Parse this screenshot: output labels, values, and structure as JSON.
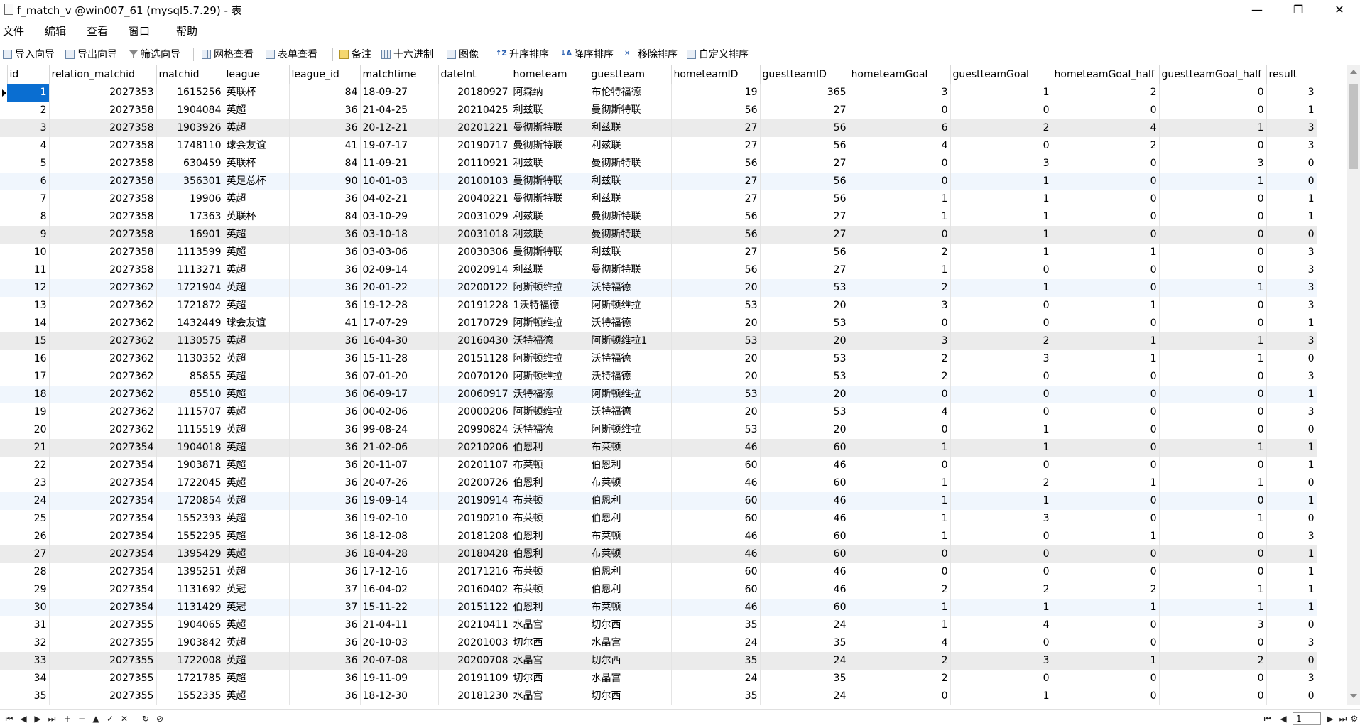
{
  "window": {
    "title": "f_match_v @win007_61 (mysql5.7.29) - 表",
    "minimize": "—",
    "maximize": "❐",
    "close": "✕"
  },
  "menu": {
    "items": [
      "文件",
      "编辑",
      "查看",
      "窗口",
      "帮助"
    ]
  },
  "toolbar": {
    "import": "导入向导",
    "export": "导出向导",
    "filter": "筛选向导",
    "grid_view": "网格查看",
    "form_view": "表单查看",
    "memo": "备注",
    "hex": "十六进制",
    "image": "图像",
    "sort_asc": "升序排序",
    "sort_desc": "降序排序",
    "remove_sort": "移除排序",
    "custom_sort": "自定义排序"
  },
  "table": {
    "columns": [
      "id",
      "relation_matchid",
      "matchid",
      "league",
      "league_id",
      "matchtime",
      "dateInt",
      "hometeam",
      "guestteam",
      "hometeamID",
      "guestteamID",
      "hometeamGoal",
      "guestteamGoal",
      "hometeamGoal_half",
      "guestteamGoal_half",
      "result"
    ],
    "rows": [
      [
        "1",
        "2027353",
        "1615256",
        "英联杯",
        "84",
        "18-09-27",
        "20180927",
        "阿森纳",
        "布伦特福德",
        "19",
        "365",
        "3",
        "1",
        "2",
        "0",
        "3"
      ],
      [
        "2",
        "2027358",
        "1904084",
        "英超",
        "36",
        "21-04-25",
        "20210425",
        "利兹联",
        "曼彻斯特联",
        "56",
        "27",
        "0",
        "0",
        "0",
        "0",
        "1"
      ],
      [
        "3",
        "2027358",
        "1903926",
        "英超",
        "36",
        "20-12-21",
        "20201221",
        "曼彻斯特联",
        "利兹联",
        "27",
        "56",
        "6",
        "2",
        "4",
        "1",
        "3"
      ],
      [
        "4",
        "2027358",
        "1748110",
        "球会友谊",
        "41",
        "19-07-17",
        "20190717",
        "曼彻斯特联",
        "利兹联",
        "27",
        "56",
        "4",
        "0",
        "2",
        "0",
        "3"
      ],
      [
        "5",
        "2027358",
        "630459",
        "英联杯",
        "84",
        "11-09-21",
        "20110921",
        "利兹联",
        "曼彻斯特联",
        "56",
        "27",
        "0",
        "3",
        "0",
        "3",
        "0"
      ],
      [
        "6",
        "2027358",
        "356301",
        "英足总杯",
        "90",
        "10-01-03",
        "20100103",
        "曼彻斯特联",
        "利兹联",
        "27",
        "56",
        "0",
        "1",
        "0",
        "1",
        "0"
      ],
      [
        "7",
        "2027358",
        "19906",
        "英超",
        "36",
        "04-02-21",
        "20040221",
        "曼彻斯特联",
        "利兹联",
        "27",
        "56",
        "1",
        "1",
        "0",
        "0",
        "1"
      ],
      [
        "8",
        "2027358",
        "17363",
        "英联杯",
        "84",
        "03-10-29",
        "20031029",
        "利兹联",
        "曼彻斯特联",
        "56",
        "27",
        "1",
        "1",
        "0",
        "0",
        "1"
      ],
      [
        "9",
        "2027358",
        "16901",
        "英超",
        "36",
        "03-10-18",
        "20031018",
        "利兹联",
        "曼彻斯特联",
        "56",
        "27",
        "0",
        "1",
        "0",
        "0",
        "0"
      ],
      [
        "10",
        "2027358",
        "1113599",
        "英超",
        "36",
        "03-03-06",
        "20030306",
        "曼彻斯特联",
        "利兹联",
        "27",
        "56",
        "2",
        "1",
        "1",
        "0",
        "3"
      ],
      [
        "11",
        "2027358",
        "1113271",
        "英超",
        "36",
        "02-09-14",
        "20020914",
        "利兹联",
        "曼彻斯特联",
        "56",
        "27",
        "1",
        "0",
        "0",
        "0",
        "3"
      ],
      [
        "12",
        "2027362",
        "1721904",
        "英超",
        "36",
        "20-01-22",
        "20200122",
        "阿斯顿维拉",
        "沃特福德",
        "20",
        "53",
        "2",
        "1",
        "0",
        "1",
        "3"
      ],
      [
        "13",
        "2027362",
        "1721872",
        "英超",
        "36",
        "19-12-28",
        "20191228",
        "1沃特福德",
        "阿斯顿维拉",
        "53",
        "20",
        "3",
        "0",
        "1",
        "0",
        "3"
      ],
      [
        "14",
        "2027362",
        "1432449",
        "球会友谊",
        "41",
        "17-07-29",
        "20170729",
        "阿斯顿维拉",
        "沃特福德",
        "20",
        "53",
        "0",
        "0",
        "0",
        "0",
        "1"
      ],
      [
        "15",
        "2027362",
        "1130575",
        "英超",
        "36",
        "16-04-30",
        "20160430",
        "沃特福德",
        "阿斯顿维拉1",
        "53",
        "20",
        "3",
        "2",
        "1",
        "1",
        "3"
      ],
      [
        "16",
        "2027362",
        "1130352",
        "英超",
        "36",
        "15-11-28",
        "20151128",
        "阿斯顿维拉",
        "沃特福德",
        "20",
        "53",
        "2",
        "3",
        "1",
        "1",
        "0"
      ],
      [
        "17",
        "2027362",
        "85855",
        "英超",
        "36",
        "07-01-20",
        "20070120",
        "阿斯顿维拉",
        "沃特福德",
        "20",
        "53",
        "2",
        "0",
        "0",
        "0",
        "3"
      ],
      [
        "18",
        "2027362",
        "85510",
        "英超",
        "36",
        "06-09-17",
        "20060917",
        "沃特福德",
        "阿斯顿维拉",
        "53",
        "20",
        "0",
        "0",
        "0",
        "0",
        "1"
      ],
      [
        "19",
        "2027362",
        "1115707",
        "英超",
        "36",
        "00-02-06",
        "20000206",
        "阿斯顿维拉",
        "沃特福德",
        "20",
        "53",
        "4",
        "0",
        "0",
        "0",
        "3"
      ],
      [
        "20",
        "2027362",
        "1115519",
        "英超",
        "36",
        "99-08-24",
        "20990824",
        "沃特福德",
        "阿斯顿维拉",
        "53",
        "20",
        "0",
        "1",
        "0",
        "0",
        "0"
      ],
      [
        "21",
        "2027354",
        "1904018",
        "英超",
        "36",
        "21-02-06",
        "20210206",
        "伯恩利",
        "布莱顿",
        "46",
        "60",
        "1",
        "1",
        "0",
        "1",
        "1"
      ],
      [
        "22",
        "2027354",
        "1903871",
        "英超",
        "36",
        "20-11-07",
        "20201107",
        "布莱顿",
        "伯恩利",
        "60",
        "46",
        "0",
        "0",
        "0",
        "0",
        "1"
      ],
      [
        "23",
        "2027354",
        "1722045",
        "英超",
        "36",
        "20-07-26",
        "20200726",
        "伯恩利",
        "布莱顿",
        "46",
        "60",
        "1",
        "2",
        "1",
        "1",
        "0"
      ],
      [
        "24",
        "2027354",
        "1720854",
        "英超",
        "36",
        "19-09-14",
        "20190914",
        "布莱顿",
        "伯恩利",
        "60",
        "46",
        "1",
        "1",
        "0",
        "0",
        "1"
      ],
      [
        "25",
        "2027354",
        "1552393",
        "英超",
        "36",
        "19-02-10",
        "20190210",
        "布莱顿",
        "伯恩利",
        "60",
        "46",
        "1",
        "3",
        "0",
        "1",
        "0"
      ],
      [
        "26",
        "2027354",
        "1552295",
        "英超",
        "36",
        "18-12-08",
        "20181208",
        "伯恩利",
        "布莱顿",
        "46",
        "60",
        "1",
        "0",
        "1",
        "0",
        "3"
      ],
      [
        "27",
        "2027354",
        "1395429",
        "英超",
        "36",
        "18-04-28",
        "20180428",
        "伯恩利",
        "布莱顿",
        "46",
        "60",
        "0",
        "0",
        "0",
        "0",
        "1"
      ],
      [
        "28",
        "2027354",
        "1395251",
        "英超",
        "36",
        "17-12-16",
        "20171216",
        "布莱顿",
        "伯恩利",
        "60",
        "46",
        "0",
        "0",
        "0",
        "0",
        "1"
      ],
      [
        "29",
        "2027354",
        "1131692",
        "英冠",
        "37",
        "16-04-02",
        "20160402",
        "布莱顿",
        "伯恩利",
        "60",
        "46",
        "2",
        "2",
        "2",
        "1",
        "1"
      ],
      [
        "30",
        "2027354",
        "1131429",
        "英冠",
        "37",
        "15-11-22",
        "20151122",
        "伯恩利",
        "布莱顿",
        "46",
        "60",
        "1",
        "1",
        "1",
        "1",
        "1"
      ],
      [
        "31",
        "2027355",
        "1904065",
        "英超",
        "36",
        "21-04-11",
        "20210411",
        "水晶宫",
        "切尔西",
        "35",
        "24",
        "1",
        "4",
        "0",
        "3",
        "0"
      ],
      [
        "32",
        "2027355",
        "1903842",
        "英超",
        "36",
        "20-10-03",
        "20201003",
        "切尔西",
        "水晶宫",
        "24",
        "35",
        "4",
        "0",
        "0",
        "0",
        "3"
      ],
      [
        "33",
        "2027355",
        "1722008",
        "英超",
        "36",
        "20-07-08",
        "20200708",
        "水晶宫",
        "切尔西",
        "35",
        "24",
        "2",
        "3",
        "1",
        "2",
        "0"
      ],
      [
        "34",
        "2027355",
        "1721785",
        "英超",
        "36",
        "19-11-09",
        "20191109",
        "切尔西",
        "水晶宫",
        "24",
        "35",
        "2",
        "0",
        "0",
        "0",
        "3"
      ],
      [
        "35",
        "2027355",
        "1552335",
        "英超",
        "36",
        "18-12-30",
        "20181230",
        "水晶宫",
        "切尔西",
        "35",
        "24",
        "0",
        "1",
        "0",
        "0",
        "0"
      ]
    ]
  },
  "status": {
    "nav_left": [
      "⏮",
      "◀",
      "▶",
      "⏭",
      "+",
      "−",
      "▲",
      "✓",
      "✕",
      "↻",
      "⊘"
    ],
    "nav_right": [
      "⏮",
      "◀"
    ],
    "page": "1",
    "nav_right2": [
      "▶",
      "⏭",
      "⚙"
    ]
  }
}
